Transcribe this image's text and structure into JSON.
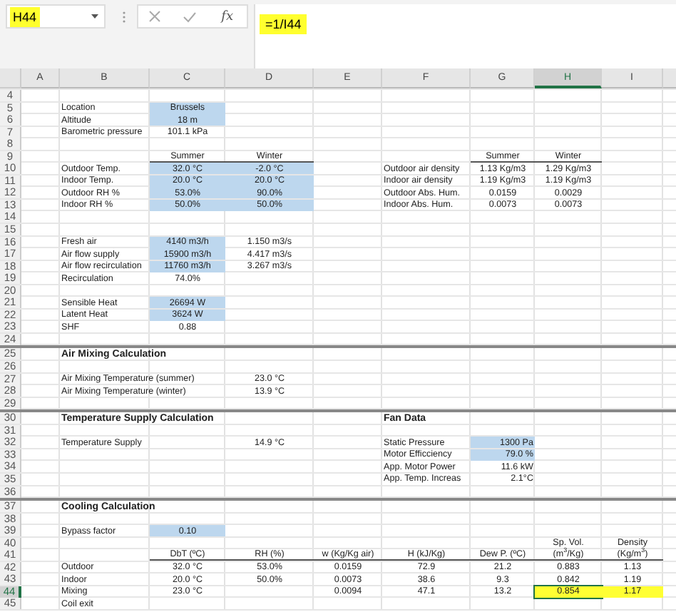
{
  "name_box": {
    "value": "H44",
    "highlighted": true
  },
  "formula_bar": {
    "function_label": "fx",
    "value": "=1/I44",
    "highlighted": true
  },
  "columns": [
    {
      "label": "A",
      "selected": false
    },
    {
      "label": "B",
      "selected": false
    },
    {
      "label": "C",
      "selected": false
    },
    {
      "label": "D",
      "selected": false
    },
    {
      "label": "E",
      "selected": false
    },
    {
      "label": "F",
      "selected": false
    },
    {
      "label": "G",
      "selected": false
    },
    {
      "label": "H",
      "selected": true
    },
    {
      "label": "I",
      "selected": false
    }
  ],
  "rows": [
    {
      "label": "4",
      "selected": false,
      "section_break": false
    },
    {
      "label": "5",
      "selected": false,
      "section_break": false,
      "cells": [
        {},
        {
          "text": "Location",
          "kind": "label"
        },
        {
          "text": "Brussels",
          "kind": "value",
          "input_cell": true
        }
      ]
    },
    {
      "label": "6",
      "selected": false,
      "section_break": false,
      "cells": [
        {},
        {
          "text": "Altitude",
          "kind": "label"
        },
        {
          "text": "18 m",
          "kind": "value",
          "input_cell": true
        }
      ]
    },
    {
      "label": "7",
      "selected": false,
      "section_break": false,
      "cells": [
        {},
        {
          "text": "Barometric pressure",
          "kind": "label"
        },
        {
          "text": "101.1 kPa",
          "kind": "value"
        }
      ]
    },
    {
      "label": "8",
      "selected": false,
      "section_break": false
    },
    {
      "label": "9",
      "selected": false,
      "section_break": false,
      "cells": [
        {},
        {},
        {
          "text": "Summer",
          "kind": "column-head"
        },
        {
          "text": "Winter",
          "kind": "column-head"
        },
        {},
        {},
        {
          "text": "Summer",
          "kind": "column-head"
        },
        {
          "text": "Winter",
          "kind": "column-head"
        }
      ]
    },
    {
      "label": "10",
      "selected": false,
      "section_break": false,
      "cells": [
        {},
        {
          "text": "Outdoor Temp.",
          "kind": "label"
        },
        {
          "text": "32.0 °C",
          "kind": "value",
          "input_cell": true
        },
        {
          "text": "-2.0 °C",
          "kind": "value",
          "input_cell": true
        },
        {},
        {
          "text": "Outdoor air density",
          "kind": "label"
        },
        {
          "text": "1.13 Kg/m3",
          "kind": "value"
        },
        {
          "text": "1.29 Kg/m3",
          "kind": "value"
        }
      ]
    },
    {
      "label": "11",
      "selected": false,
      "section_break": false,
      "cells": [
        {},
        {
          "text": "Indoor Temp.",
          "kind": "label"
        },
        {
          "text": "20.0 °C",
          "kind": "value",
          "input_cell": true
        },
        {
          "text": "20.0 °C",
          "kind": "value",
          "input_cell": true
        },
        {},
        {
          "text": "Indoor air density",
          "kind": "label"
        },
        {
          "text": "1.19 Kg/m3",
          "kind": "value"
        },
        {
          "text": "1.19 Kg/m3",
          "kind": "value"
        }
      ]
    },
    {
      "label": "12",
      "selected": false,
      "section_break": false,
      "cells": [
        {},
        {
          "text": "Outdoor RH %",
          "kind": "label"
        },
        {
          "text": "53.0%",
          "kind": "value",
          "input_cell": true
        },
        {
          "text": "90.0%",
          "kind": "value",
          "input_cell": true
        },
        {},
        {
          "text": "Outdoor Abs. Hum.",
          "kind": "label"
        },
        {
          "text": "0.0159",
          "kind": "value"
        },
        {
          "text": "0.0029",
          "kind": "value"
        }
      ]
    },
    {
      "label": "13",
      "selected": false,
      "section_break": false,
      "cells": [
        {},
        {
          "text": "Indoor RH %",
          "kind": "label"
        },
        {
          "text": "50.0%",
          "kind": "value",
          "input_cell": true
        },
        {
          "text": "50.0%",
          "kind": "value",
          "input_cell": true
        },
        {},
        {
          "text": "Indoor Abs. Hum.",
          "kind": "label"
        },
        {
          "text": "0.0073",
          "kind": "value"
        },
        {
          "text": "0.0073",
          "kind": "value"
        }
      ]
    },
    {
      "label": "14",
      "selected": false,
      "section_break": false
    },
    {
      "label": "15",
      "selected": false,
      "section_break": false
    },
    {
      "label": "16",
      "selected": false,
      "section_break": false,
      "cells": [
        {},
        {
          "text": "Fresh air",
          "kind": "label"
        },
        {
          "text": "4140 m3/h",
          "kind": "value",
          "input_cell": true
        },
        {
          "text": "1.150 m3/s",
          "kind": "value"
        }
      ]
    },
    {
      "label": "17",
      "selected": false,
      "section_break": false,
      "cells": [
        {},
        {
          "text": "Air flow supply",
          "kind": "label"
        },
        {
          "text": "15900 m3/h",
          "kind": "value",
          "input_cell": true
        },
        {
          "text": "4.417 m3/s",
          "kind": "value"
        }
      ]
    },
    {
      "label": "18",
      "selected": false,
      "section_break": false,
      "cells": [
        {},
        {
          "text": "Air flow recirculation",
          "kind": "label"
        },
        {
          "text": "11760 m3/h",
          "kind": "value",
          "input_cell": true
        },
        {
          "text": "3.267 m3/s",
          "kind": "value"
        }
      ]
    },
    {
      "label": "19",
      "selected": false,
      "section_break": false,
      "cells": [
        {},
        {
          "text": "Recirculation",
          "kind": "label"
        },
        {
          "text": "74.0%",
          "kind": "value"
        }
      ]
    },
    {
      "label": "20",
      "selected": false,
      "section_break": false
    },
    {
      "label": "21",
      "selected": false,
      "section_break": false,
      "cells": [
        {},
        {
          "text": "Sensible Heat",
          "kind": "label"
        },
        {
          "text": "26694 W",
          "kind": "value",
          "input_cell": true
        }
      ]
    },
    {
      "label": "22",
      "selected": false,
      "section_break": false,
      "cells": [
        {},
        {
          "text": "Latent Heat",
          "kind": "label"
        },
        {
          "text": "3624 W",
          "kind": "value",
          "input_cell": true
        }
      ]
    },
    {
      "label": "23",
      "selected": false,
      "section_break": false,
      "cells": [
        {},
        {
          "text": "SHF",
          "kind": "label"
        },
        {
          "text": "0.88",
          "kind": "value"
        }
      ]
    },
    {
      "label": "24",
      "selected": false,
      "section_break": false
    },
    {
      "label": "25",
      "selected": false,
      "section_break": true,
      "cells": [
        {},
        {
          "text": "Air Mixing Calculation",
          "kind": "heading"
        }
      ]
    },
    {
      "label": "26",
      "selected": false,
      "section_break": false
    },
    {
      "label": "27",
      "selected": false,
      "section_break": false,
      "cells": [
        {},
        {
          "text": "Air Mixing Temperature (summer)",
          "kind": "label"
        },
        {},
        {
          "text": "23.0 °C",
          "kind": "value"
        }
      ]
    },
    {
      "label": "28",
      "selected": false,
      "section_break": false,
      "cells": [
        {},
        {
          "text": "Air Mixing Temperature (winter)",
          "kind": "label"
        },
        {},
        {
          "text": "13.9 °C",
          "kind": "value"
        }
      ]
    },
    {
      "label": "29",
      "selected": false,
      "section_break": false
    },
    {
      "label": "30",
      "selected": false,
      "section_break": true,
      "cells": [
        {},
        {
          "text": "Temperature Supply Calculation",
          "kind": "heading"
        },
        {},
        {},
        {},
        {
          "text": "Fan Data",
          "kind": "heading"
        }
      ]
    },
    {
      "label": "31",
      "selected": false,
      "section_break": false
    },
    {
      "label": "32",
      "selected": false,
      "section_break": false,
      "cells": [
        {},
        {
          "text": "Temperature Supply",
          "kind": "label"
        },
        {},
        {
          "text": "14.9 °C",
          "kind": "value"
        },
        {},
        {
          "text": "Static Pressure",
          "kind": "label"
        },
        {
          "text": "1300 Pa",
          "kind": "value-right",
          "input_cell": true
        }
      ]
    },
    {
      "label": "33",
      "selected": false,
      "section_break": false,
      "cells": [
        {},
        {},
        {},
        {},
        {},
        {
          "text": "Motor Efficciency",
          "kind": "label"
        },
        {
          "text": "79.0 %",
          "kind": "value-right",
          "input_cell": true
        }
      ]
    },
    {
      "label": "34",
      "selected": false,
      "section_break": false,
      "cells": [
        {},
        {},
        {},
        {},
        {},
        {
          "text": "App. Motor Power",
          "kind": "label"
        },
        {
          "text": "11.6 kW",
          "kind": "value-right"
        }
      ]
    },
    {
      "label": "35",
      "selected": false,
      "section_break": false,
      "cells": [
        {},
        {},
        {},
        {},
        {},
        {
          "text": "App. Temp. Increas",
          "kind": "label"
        },
        {
          "text": "2.1°C",
          "kind": "value-right"
        }
      ]
    },
    {
      "label": "36",
      "selected": false,
      "section_break": false
    },
    {
      "label": "37",
      "selected": false,
      "section_break": true,
      "cells": [
        {},
        {
          "text": "Cooling Calculation",
          "kind": "heading"
        }
      ]
    },
    {
      "label": "38",
      "selected": false,
      "section_break": false
    },
    {
      "label": "39",
      "selected": false,
      "section_break": false,
      "cells": [
        {},
        {
          "text": "Bypass factor",
          "kind": "label"
        },
        {
          "text": "0.10",
          "kind": "value",
          "input_cell": true
        }
      ]
    },
    {
      "label": "40",
      "selected": false,
      "section_break": false,
      "cells": [
        {},
        {},
        {},
        {},
        {},
        {},
        {},
        {
          "text": "Sp. Vol.",
          "kind": "value"
        },
        {
          "text": "Density",
          "kind": "value"
        }
      ]
    },
    {
      "label": "41",
      "selected": false,
      "section_break": false,
      "cells": [
        {},
        {},
        {
          "text": "DbT (ºC)",
          "kind": "column-head"
        },
        {
          "text": "RH (%)",
          "kind": "column-head"
        },
        {
          "text": "w (Kg/Kg air)",
          "kind": "column-head"
        },
        {
          "text": "H (kJ/Kg)",
          "kind": "column-head"
        },
        {
          "text": "Dew P. (ºC)",
          "kind": "column-head"
        },
        {
          "text": "(m$^{3}$/Kg)",
          "kind": "column-head"
        },
        {
          "text": "(Kg/m$^{3}$)",
          "kind": "column-head"
        }
      ]
    },
    {
      "label": "42",
      "selected": false,
      "section_break": false,
      "cells": [
        {},
        {
          "text": "Outdoor",
          "kind": "label"
        },
        {
          "text": "32.0 °C",
          "kind": "value"
        },
        {
          "text": "53.0%",
          "kind": "value"
        },
        {
          "text": "0.0159",
          "kind": "value"
        },
        {
          "text": "72.9",
          "kind": "value"
        },
        {
          "text": "21.2",
          "kind": "value"
        },
        {
          "text": "0.883",
          "kind": "value"
        },
        {
          "text": "1.13",
          "kind": "value"
        }
      ]
    },
    {
      "label": "43",
      "selected": false,
      "section_break": false,
      "cells": [
        {},
        {
          "text": "Indoor",
          "kind": "label"
        },
        {
          "text": "20.0 °C",
          "kind": "value"
        },
        {
          "text": "50.0%",
          "kind": "value"
        },
        {
          "text": "0.0073",
          "kind": "value"
        },
        {
          "text": "38.6",
          "kind": "value"
        },
        {
          "text": "9.3",
          "kind": "value"
        },
        {
          "text": "0.842",
          "kind": "value"
        },
        {
          "text": "1.19",
          "kind": "value"
        }
      ]
    },
    {
      "label": "44",
      "selected": true,
      "section_break": false,
      "cells": [
        {},
        {
          "text": "Mixing",
          "kind": "label"
        },
        {
          "text": "23.0 °C",
          "kind": "value"
        },
        {},
        {
          "text": "0.0094",
          "kind": "value"
        },
        {
          "text": "47.1",
          "kind": "value"
        },
        {
          "text": "13.2",
          "kind": "value"
        },
        {
          "text": "0.854",
          "kind": "value",
          "highlighted": true,
          "selected": true
        },
        {
          "text": "1.17",
          "kind": "value",
          "highlighted": true
        }
      ]
    },
    {
      "label": "45",
      "selected": false,
      "section_break": false,
      "cells": [
        {},
        {
          "text": "Coil exit",
          "kind": "label"
        }
      ]
    }
  ]
}
